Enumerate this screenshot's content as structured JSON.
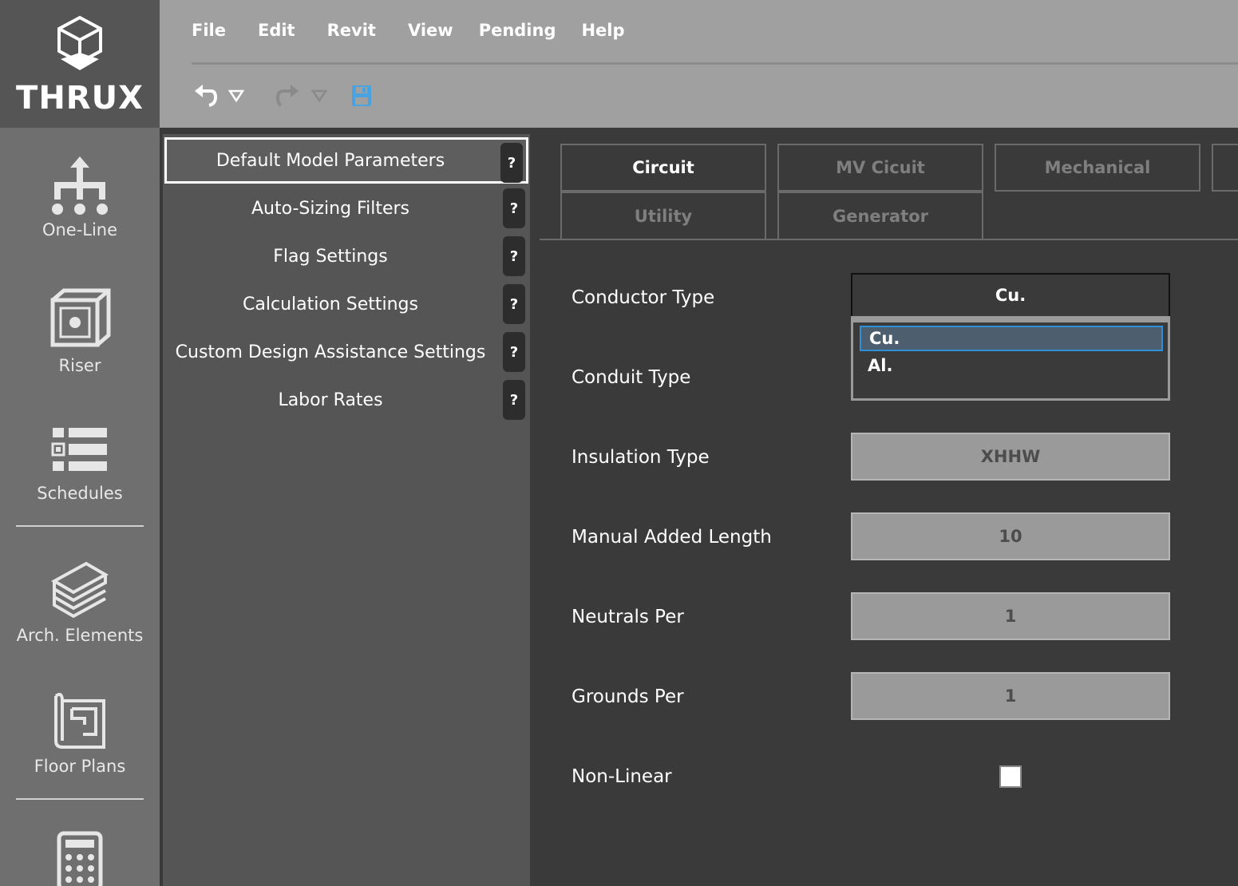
{
  "brand": {
    "name": "THRUX"
  },
  "rail": {
    "items": [
      {
        "label": "One-Line",
        "icon": "hierarchy-icon"
      },
      {
        "label": "Riser",
        "icon": "cube-icon"
      },
      {
        "label": "Schedules",
        "icon": "list-icon"
      },
      {
        "label": "Arch. Elements",
        "icon": "layers-icon"
      },
      {
        "label": "Floor Plans",
        "icon": "blueprint-icon"
      },
      {
        "label": "",
        "icon": "calculator-icon"
      }
    ]
  },
  "menu": {
    "file": "File",
    "edit": "Edit",
    "revit": "Revit",
    "view": "View",
    "pending": "Pending",
    "help": "Help"
  },
  "toolbar": {
    "accent": "#4aa3df"
  },
  "settings": {
    "items": [
      {
        "label": "Default Model Parameters",
        "help": "?"
      },
      {
        "label": "Auto-Sizing Filters",
        "help": "?"
      },
      {
        "label": "Flag Settings",
        "help": "?"
      },
      {
        "label": "Calculation Settings",
        "help": "?"
      },
      {
        "label": "Custom Design Assistance Settings",
        "help": "?"
      },
      {
        "label": "Labor Rates",
        "help": "?"
      }
    ]
  },
  "tabs": {
    "circuit": "Circuit",
    "mv": "MV Cicuit",
    "mechanical": "Mechanical",
    "utility": "Utility",
    "generator": "Generator"
  },
  "form": {
    "conductor_type": {
      "label": "Conductor Type",
      "value": "Cu.",
      "options": [
        "Cu.",
        "Al."
      ]
    },
    "conduit_type": {
      "label": "Conduit Type"
    },
    "insulation_type": {
      "label": "Insulation Type",
      "value": "XHHW"
    },
    "manual_added_length": {
      "label": "Manual Added Length",
      "value": "10"
    },
    "neutrals_per": {
      "label": "Neutrals Per",
      "value": "1"
    },
    "grounds_per": {
      "label": "Grounds Per",
      "value": "1"
    },
    "non_linear": {
      "label": "Non-Linear",
      "checked": false
    }
  }
}
